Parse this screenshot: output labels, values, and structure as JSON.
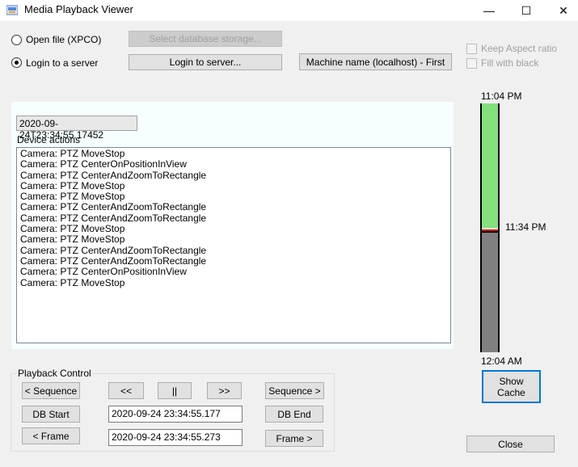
{
  "window": {
    "title": "Media Playback Viewer",
    "minimize": "—",
    "maximize": "☐",
    "close": "✕"
  },
  "source": {
    "open_file_label": "Open file (XPCO)",
    "login_label": "Login to a server",
    "selected": "login"
  },
  "buttons": {
    "select_db": "Select database storage...",
    "login_server": "Login to server...",
    "machine_name": "Machine name (localhost) - First",
    "show_cache": "Show\nCache",
    "close": "Close"
  },
  "options": {
    "keep_aspect": "Keep Aspect ratio",
    "fill_black": "Fill with black"
  },
  "timestamp": "2020-09-24T23:34:55.17452",
  "device_actions": {
    "label": "Device actions",
    "items": [
      "Camera: PTZ MoveStop",
      "Camera: PTZ CenterOnPositionInView",
      "Camera: PTZ CenterAndZoomToRectangle",
      "Camera: PTZ MoveStop",
      "Camera: PTZ MoveStop",
      "Camera: PTZ CenterAndZoomToRectangle",
      "Camera: PTZ CenterAndZoomToRectangle",
      "Camera: PTZ MoveStop",
      "Camera: PTZ MoveStop",
      "Camera: PTZ CenterAndZoomToRectangle",
      "Camera: PTZ CenterAndZoomToRectangle",
      "Camera: PTZ CenterOnPositionInView",
      "Camera: PTZ MoveStop"
    ]
  },
  "playback": {
    "group_label": "Playback Control",
    "prev_sequence": "< Sequence",
    "rewind": "<<",
    "pause": "||",
    "forward": ">>",
    "next_sequence": "Sequence >",
    "db_start": "DB Start",
    "db_end": "DB End",
    "prev_frame": "< Frame",
    "next_frame": "Frame >",
    "time1": "2020-09-24 23:34:55.177",
    "time2": "2020-09-24 23:34:55.273"
  },
  "timeline": {
    "top_label": "11:04 PM",
    "mid_label": "11:34 PM",
    "bottom_label": "12:04 AM",
    "cached_fraction": 0.5,
    "colors": {
      "cached": "#84e07d",
      "uncached": "#808080",
      "marker": "#e00000"
    }
  }
}
